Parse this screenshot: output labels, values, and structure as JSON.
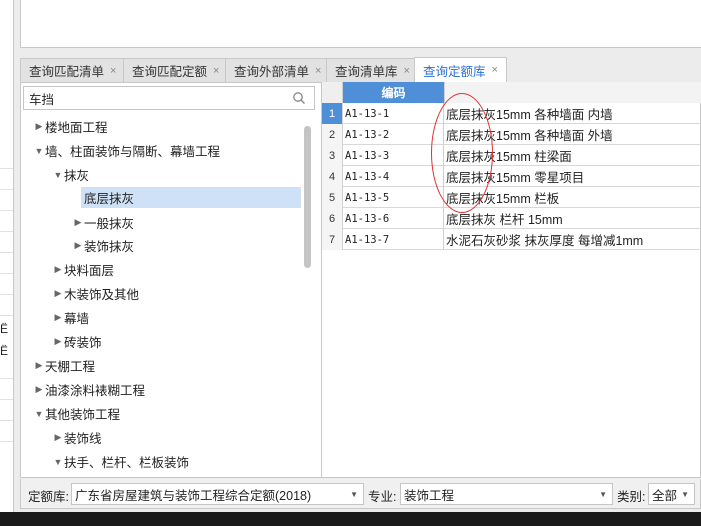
{
  "left_strip": {
    "texts": [
      "Ë",
      "Ë"
    ]
  },
  "tabs": [
    {
      "label": "查询匹配清单",
      "active": false
    },
    {
      "label": "查询匹配定额",
      "active": false
    },
    {
      "label": "查询外部清单",
      "active": false
    },
    {
      "label": "查询清单库",
      "active": false
    },
    {
      "label": "查询定额库",
      "active": true
    }
  ],
  "tab_close_glyph": "×",
  "search": {
    "value": "车挡",
    "icon": "search-icon"
  },
  "tree": {
    "items": [
      {
        "label": "楼地面工程",
        "level": 0,
        "expanded": false
      },
      {
        "label": "墙、柱面装饰与隔断、幕墙工程",
        "level": 0,
        "expanded": true
      },
      {
        "label": "抹灰",
        "level": 1,
        "expanded": true
      },
      {
        "label": "底层抹灰",
        "level": 2,
        "leaf": true,
        "selected": true
      },
      {
        "label": "一般抹灰",
        "level": 2,
        "expanded": false
      },
      {
        "label": "装饰抹灰",
        "level": 2,
        "expanded": false
      },
      {
        "label": "块料面层",
        "level": 1,
        "expanded": false
      },
      {
        "label": "木装饰及其他",
        "level": 1,
        "expanded": false
      },
      {
        "label": "幕墙",
        "level": 1,
        "expanded": false
      },
      {
        "label": "砖装饰",
        "level": 1,
        "expanded": false
      },
      {
        "label": "天棚工程",
        "level": 0,
        "expanded": false
      },
      {
        "label": "油漆涂料裱糊工程",
        "level": 0,
        "expanded": false
      },
      {
        "label": "其他装饰工程",
        "level": 0,
        "expanded": true
      },
      {
        "label": "装饰线",
        "level": 1,
        "expanded": false
      },
      {
        "label": "扶手、栏杆、栏板装饰",
        "level": 1,
        "expanded": true
      }
    ]
  },
  "table": {
    "header": {
      "code": "编码",
      "name": ""
    },
    "rows": [
      {
        "no": "1",
        "code": "A1-13-1",
        "name": "底层抹灰15mm 各种墙面 内墙",
        "selected": true
      },
      {
        "no": "2",
        "code": "A1-13-2",
        "name": "底层抹灰15mm 各种墙面 外墙",
        "selected": false
      },
      {
        "no": "3",
        "code": "A1-13-3",
        "name": "底层抹灰15mm 柱梁面",
        "selected": false
      },
      {
        "no": "4",
        "code": "A1-13-4",
        "name": "底层抹灰15mm 零星项目",
        "selected": false
      },
      {
        "no": "5",
        "code": "A1-13-5",
        "name": "底层抹灰15mm 栏板",
        "selected": false
      },
      {
        "no": "6",
        "code": "A1-13-6",
        "name": "底层抹灰 栏杆 15mm",
        "selected": false
      },
      {
        "no": "7",
        "code": "A1-13-7",
        "name": "水泥石灰砂浆 抹灰厚度 每增减1mm",
        "selected": false
      }
    ]
  },
  "bottom": {
    "quota_label": "定额库:",
    "quota_value": "广东省房屋建筑与装饰工程综合定额(2018)",
    "major_label": "专业:",
    "major_value": "装饰工程",
    "category_label": "类别:",
    "category_value": "全部"
  },
  "colors": {
    "accent": "#4f8fd8",
    "tab_active_text": "#2a6fd6",
    "annotation": "#e03030",
    "selected_row": "#cfe1f7"
  }
}
